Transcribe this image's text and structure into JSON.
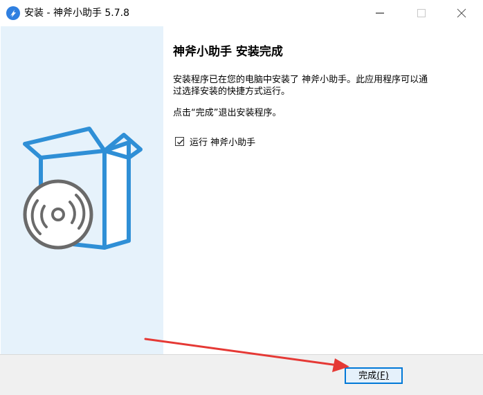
{
  "window": {
    "title": "安装 - 神斧小助手 5.7.8",
    "icon": "app-logo-icon",
    "controls": [
      "minimize-icon",
      "maximize-icon",
      "close-icon"
    ]
  },
  "panel": {
    "heading": "神斧小助手 安装完成",
    "description_lines": [
      "安装程序已在您的电脑中安装了 神斧小助手。此应用程序可以通",
      "过选择安装的快捷方式运行。"
    ],
    "hint": "点击“完成”退出安装程序。",
    "run_option": {
      "label": "运行 神斧小助手",
      "checked": true
    }
  },
  "footer": {
    "finish_label": "完成",
    "finish_accelerator": "(F)"
  },
  "colors": {
    "accent": "#0078d7",
    "left_panel": "#e6f2fb",
    "box_blue": "#2f8fd6",
    "disc_gray": "#6a6a6a",
    "annotation_arrow": "#e53935"
  }
}
